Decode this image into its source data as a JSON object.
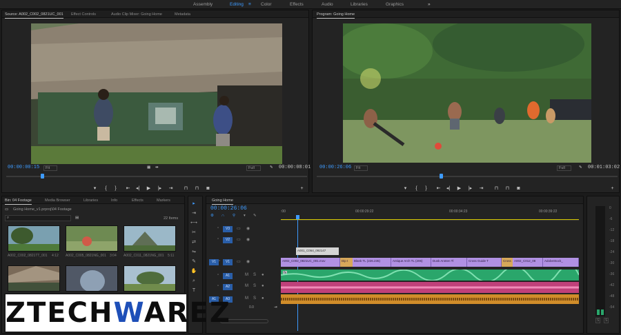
{
  "workspaces": {
    "items": [
      "Assembly",
      "Editing",
      "Color",
      "Effects",
      "Audio",
      "Libraries",
      "Graphics"
    ],
    "active": "Editing",
    "more": "»"
  },
  "source": {
    "tabs": [
      "Source: A002_C002_0821UC_001",
      "Effect Controls",
      "Audio Clip Mixer: Going Home",
      "Metadata"
    ],
    "timecode_in": "00:00:00:15",
    "fit": "Fit",
    "quality": "Full",
    "duration": "00:00:08:01"
  },
  "program": {
    "tab": "Program: Going Home",
    "timecode": "00:00:26:06",
    "fit": "Fit",
    "quality": "Full",
    "duration": "00:01:03:02"
  },
  "transport": {
    "mark_in": "{",
    "mark_out": "}",
    "step_back": "◂|",
    "play": "▶",
    "step_fwd": "|▸",
    "insert": "⊓",
    "overwrite": "⊓",
    "export_frame": "◙",
    "add": "+"
  },
  "project": {
    "tabs": [
      "Bin: 04 Footage",
      "Media Browser",
      "Libraries",
      "Info",
      "Effects",
      "Markers"
    ],
    "path": "Going Home_v1.prproj\\04 Footage",
    "search_placeholder": "",
    "count": "22 Items",
    "clips": [
      {
        "name": "A002_C002_0821TT_001",
        "dur": "4:12"
      },
      {
        "name": "A002_C005_0821NG_001",
        "dur": "3:04"
      },
      {
        "name": "A002_C011_0821NG_001",
        "dur": "5:11"
      },
      {
        "name": "",
        "dur": ""
      },
      {
        "name": "",
        "dur": ""
      },
      {
        "name": "",
        "dur": ""
      }
    ]
  },
  "timeline": {
    "tab": "Going Home",
    "timecode": "00:00:26:06",
    "ruler": [
      ":00",
      "00:00:29:22",
      "00:00:34:23",
      "00:00:39:22"
    ],
    "tracks_video": [
      "V3",
      "V2",
      "V1"
    ],
    "tracks_audio": [
      "A1",
      "A2",
      "A3"
    ],
    "source_patch_v": "V1",
    "source_patch_a": "A1",
    "master_level": "0.0",
    "floating_clip": "A001_C064_092147",
    "clips_v1": [
      "A002_C002_0821UC_001.mov",
      "Dip t",
      "Blank TL (226.235)",
      "Antique Arch TL (206)",
      "Dusk Annten Tl",
      "Cross Guide T",
      "A002_C012_08",
      "AdobeStock_"
    ],
    "cross_label": "Cross",
    "a1_label": "fx"
  },
  "meter": {
    "ticks": [
      "0",
      "-6",
      "-12",
      "-18",
      "-24",
      "-30",
      "-36",
      "-42",
      "-48",
      "-54"
    ],
    "bottom": [
      "S",
      "S"
    ]
  },
  "tools": [
    "▸",
    "⇥",
    "⟷",
    "✂",
    "⇄",
    "⇋",
    "✎",
    "✋",
    "⌕",
    "T"
  ],
  "logo": {
    "part1": "ZTECH",
    "part2": "W",
    "part3": "AREZ"
  },
  "colors": {
    "accent": "#3e9bff",
    "video_clip": "#b191e3",
    "audio_green": "#2aa66b",
    "audio_pink": "#c0407a",
    "audio_orange": "#d08d2a"
  }
}
